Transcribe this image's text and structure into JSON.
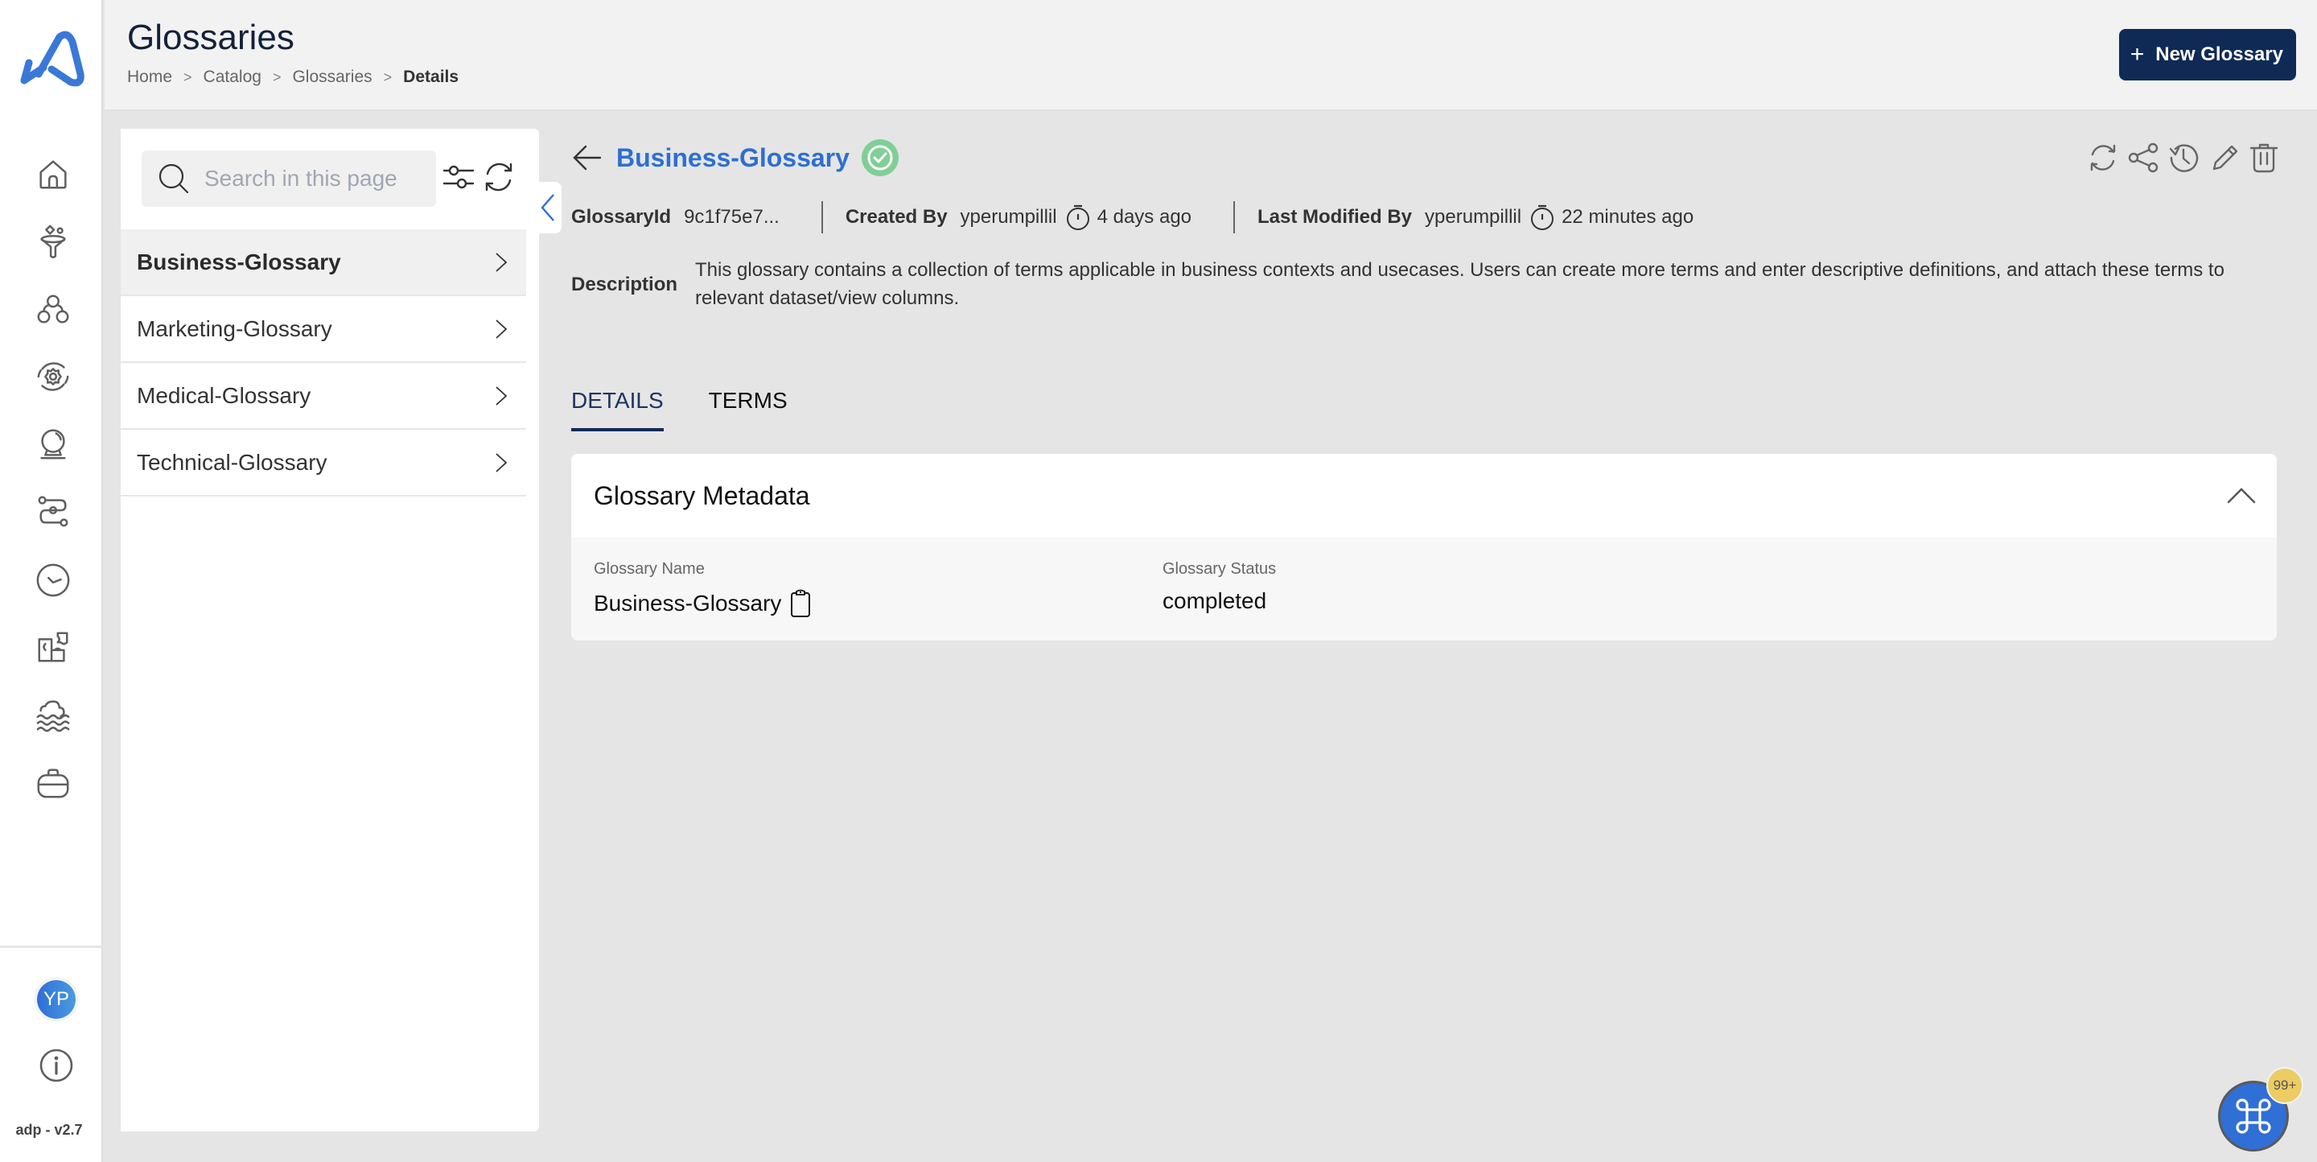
{
  "app": {
    "version": "adp - v2.7",
    "brand_color": "#2f6fd6",
    "primary_dark": "#0f2a55"
  },
  "rail": {
    "items": [
      {
        "icon": "home-icon",
        "label": "Home"
      },
      {
        "icon": "funnel-icon",
        "label": "Ingestion"
      },
      {
        "icon": "hierarchy-icon",
        "label": "Catalog"
      },
      {
        "icon": "settings-cycle-icon",
        "label": "Processing"
      },
      {
        "icon": "crystal-ball-icon",
        "label": "Insights"
      },
      {
        "icon": "pipeline-icon",
        "label": "Pipelines"
      },
      {
        "icon": "clock-icon",
        "label": "Schedules"
      },
      {
        "icon": "puzzle-icon",
        "label": "Integrations"
      },
      {
        "icon": "data-lake-icon",
        "label": "Data Lake"
      },
      {
        "icon": "briefcase-icon",
        "label": "Workspace"
      }
    ],
    "avatar_initials": "YP"
  },
  "header": {
    "title": "Glossaries",
    "breadcrumb": [
      "Home",
      "Catalog",
      "Glossaries",
      "Details"
    ],
    "new_button_label": "New Glossary"
  },
  "panel": {
    "search_placeholder": "Search in this page",
    "search_value": "",
    "items": [
      {
        "label": "Business-Glossary",
        "active": true
      },
      {
        "label": "Marketing-Glossary",
        "active": false
      },
      {
        "label": "Medical-Glossary",
        "active": false
      },
      {
        "label": "Technical-Glossary",
        "active": false
      }
    ]
  },
  "detail": {
    "title": "Business-Glossary",
    "status_color": "#7fcf96",
    "meta": {
      "id_label": "GlossaryId",
      "id_value": "9c1f75e7...",
      "created_label": "Created By",
      "created_by": "yperumpillil",
      "created_ago": "4 days ago",
      "modified_label": "Last Modified By",
      "modified_by": "yperumpillil",
      "modified_ago": "22 minutes ago"
    },
    "description_label": "Description",
    "description": "This glossary contains a collection of terms applicable in business contexts and usecases. Users can create more terms and enter descriptive definitions, and attach these terms to relevant dataset/view columns.",
    "tabs": [
      {
        "label": "DETAILS",
        "active": true
      },
      {
        "label": "TERMS",
        "active": false
      }
    ],
    "card": {
      "title": "Glossary Metadata",
      "fields": [
        {
          "label": "Glossary Name",
          "value": "Business-Glossary"
        },
        {
          "label": "Glossary Status",
          "value": "completed"
        }
      ]
    }
  },
  "fab": {
    "badge": "99+"
  }
}
